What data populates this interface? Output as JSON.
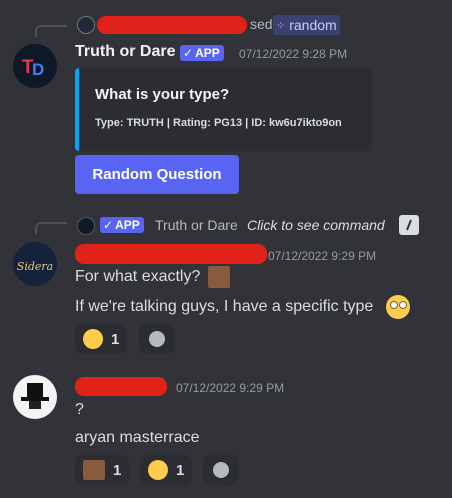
{
  "message1": {
    "reply_suffix": "sed",
    "reply_command": "random",
    "author": "Truth or Dare",
    "app_badge": "APP",
    "timestamp": "07/12/2022 9:28 PM",
    "avatar_text": "TD",
    "embed": {
      "title": "What is your type?",
      "description": "Type: TRUTH | Rating: PG13 | ID: kw6u7ikto9on"
    },
    "button_label": "Random Question"
  },
  "message2": {
    "reply_app_badge": "APP",
    "reply_author": "Truth or Dare",
    "reply_hint": "Click to see command",
    "timestamp": "07/12/2022 9:29 PM",
    "avatar_text": "Sidera",
    "lines": [
      "For what exactly?",
      "If we're talking guys, I have a specific type"
    ],
    "reactions": [
      {
        "emoji": "laughing-emoji",
        "count": "1"
      }
    ]
  },
  "message3": {
    "timestamp": "07/12/2022 9:29 PM",
    "lines": [
      "?",
      "aryan masterrace"
    ],
    "reactions": [
      {
        "emoji": "face-image-emoji",
        "count": "1"
      },
      {
        "emoji": "grimacing-emoji",
        "count": "1"
      }
    ]
  },
  "colors": {
    "background": "#313338",
    "blurple": "#5865f2",
    "embed_accent": "#00a8fc",
    "redaction": "#e0221b"
  }
}
